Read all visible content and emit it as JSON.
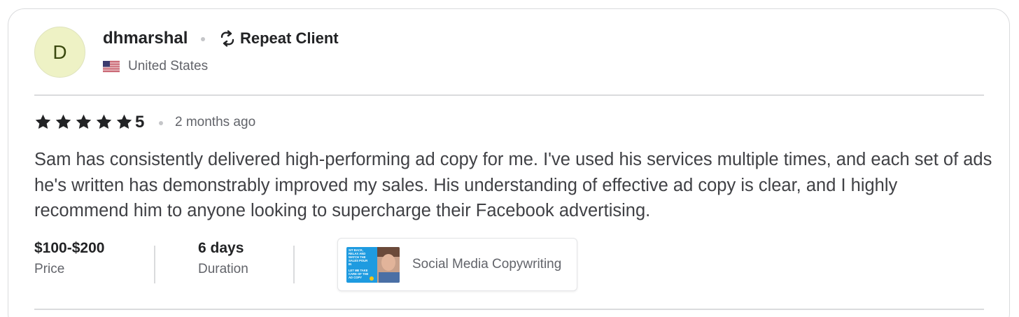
{
  "reviewer": {
    "avatar_initial": "D",
    "username": "dhmarshal",
    "badge": "Repeat Client",
    "badge_icon": "repeat-icon",
    "country": "United States",
    "country_flag": "us-flag-icon"
  },
  "rating": {
    "stars": 5,
    "value": "5",
    "time_ago": "2 months ago"
  },
  "review": {
    "text": "Sam has consistently delivered high-performing ad copy for me. I've used his services multiple times, and each set of ads he's written has demonstrably improved my sales. His understanding of effective ad copy is clear, and I highly recommend him to anyone looking to supercharge their Facebook advertising."
  },
  "meta": {
    "price_value": "$100-$200",
    "price_label": "Price",
    "duration_value": "6 days",
    "duration_label": "Duration"
  },
  "gig": {
    "title": "Social Media Copywriting",
    "thumbnail_lines": [
      "SIT BACK,",
      "RELAX AND",
      "WATCH THE",
      "SALES POUR",
      "IN",
      "LET ME TAKE",
      "CARE OF THE",
      "AD COPY"
    ]
  },
  "colors": {
    "avatar_bg": "#eef2c5",
    "text_primary": "#222325",
    "text_secondary": "#62646a",
    "divider": "#dadbdd",
    "thumb_bg": "#1e9be0"
  }
}
